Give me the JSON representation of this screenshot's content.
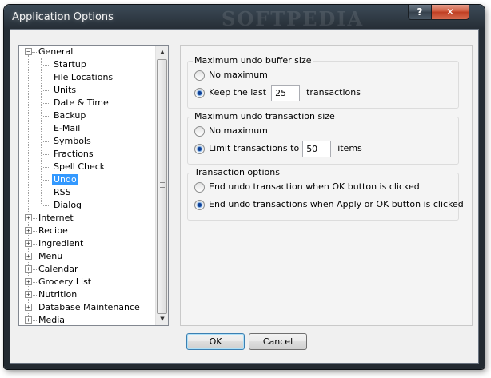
{
  "window": {
    "title": "Application Options",
    "watermark": "SOFTPEDIA",
    "help_label": "?",
    "close_label": "✕"
  },
  "tree": {
    "general": "General",
    "general_children": [
      "Startup",
      "File Locations",
      "Units",
      "Date & Time",
      "Backup",
      "E-Mail",
      "Symbols",
      "Fractions",
      "Spell Check",
      "Undo",
      "RSS",
      "Dialog"
    ],
    "selected": "Undo",
    "roots": [
      "Internet",
      "Recipe",
      "Ingredient",
      "Menu",
      "Calendar",
      "Grocery List",
      "Nutrition",
      "Database Maintenance",
      "Media"
    ],
    "expanded_glyph": "−",
    "collapsed_glyph": "+"
  },
  "panel": {
    "buffer_group": {
      "title": "Maximum undo buffer size",
      "no_max_label": "No maximum",
      "keep_last_label": "Keep the last",
      "keep_last_value": "25",
      "keep_last_unit": "transactions",
      "selected": "keep_last"
    },
    "transaction_group": {
      "title": "Maximum undo transaction size",
      "no_max_label": "No maximum",
      "limit_label": "Limit transactions to",
      "limit_value": "50",
      "limit_unit": "items",
      "selected": "limit"
    },
    "options_group": {
      "title": "Transaction options",
      "opt_ok_label": "End undo transaction when OK button is clicked",
      "opt_apply_ok_label": "End undo transactions when Apply or OK button is clicked",
      "selected": "apply_ok"
    }
  },
  "buttons": {
    "ok": "OK",
    "cancel": "Cancel"
  },
  "colors": {
    "titlebar": "#262e36",
    "selection": "#3399ff",
    "close_button": "#cf5b3f"
  }
}
